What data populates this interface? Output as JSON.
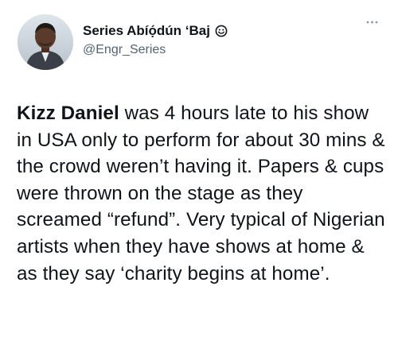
{
  "tweet": {
    "author": {
      "display_name": "Series Abíọ́dún ‘Baj",
      "handle": "@Engr_Series",
      "status_icon": "smiley-icon",
      "avatar_icon": "profile-photo"
    },
    "more_icon": "more-options-icon",
    "body": {
      "bold_name": "Kizz Daniel",
      "text": " was 4 hours late to his show in USA only to perform for about 30 mins & the crowd weren’t having it. Papers & cups were thrown on the stage as they screamed “refund”. Very typical of Nigerian artists when they have shows at home & as they say ‘charity begins at home’."
    }
  },
  "colors": {
    "text_primary": "#0f1419",
    "text_secondary": "#536471",
    "background": "#ffffff"
  }
}
